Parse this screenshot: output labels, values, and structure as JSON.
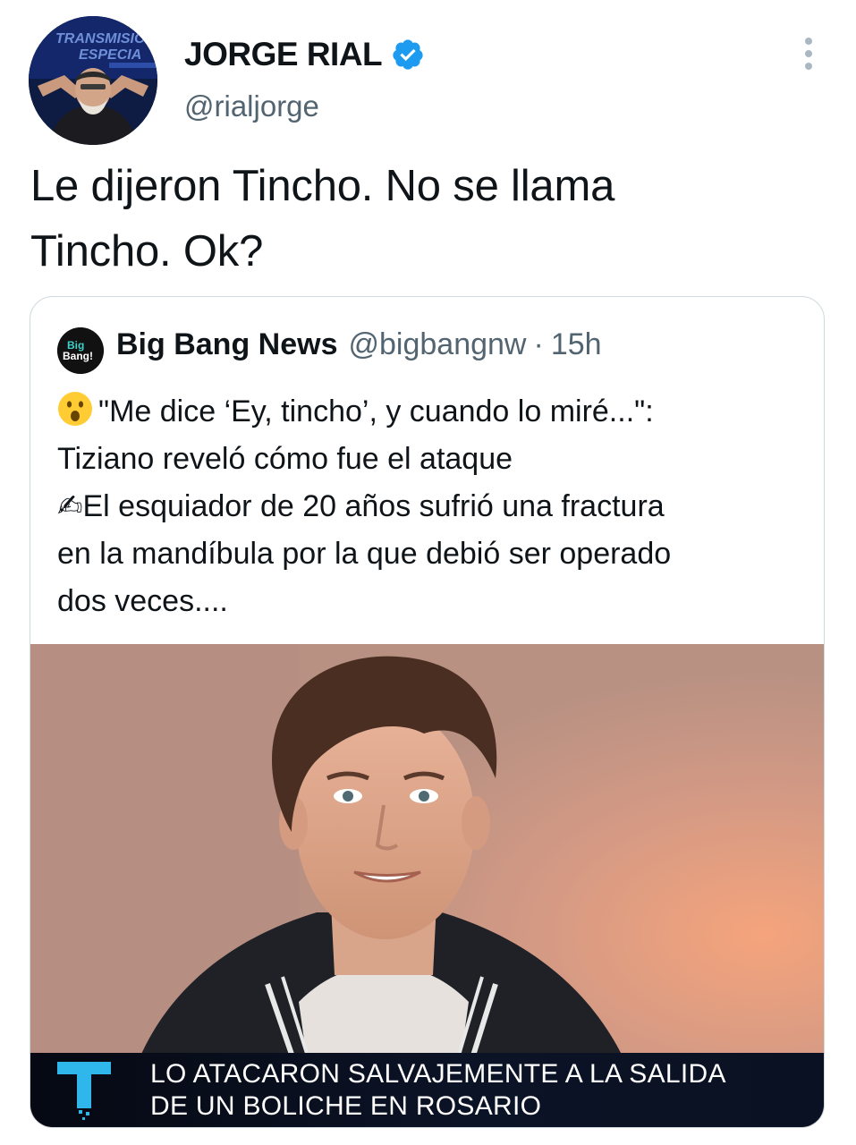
{
  "tweet": {
    "author_name": "JORGE RIAL",
    "author_handle": "@rialjorge",
    "avatar_overlay_text": [
      "TRANSMISIÓ",
      "ESPECIA"
    ],
    "text_line1": "Le dijeron Tincho. No se llama",
    "text_line2": "Tincho. Ok?",
    "more_icon": "more-vertical-icon",
    "verified_icon": "verified-badge-icon",
    "accent_color": "#1d9bf0"
  },
  "quote": {
    "avatar_text": [
      "Big",
      "Bang!"
    ],
    "author_name": "Big Bang News",
    "author_handle": "@bigbangnw",
    "separator": "·",
    "time": "15h",
    "emoji_icon": "surprised-face-emoji",
    "line1": "\"Me dice ‘Ey, tincho’, y cuando lo miré...\":",
    "line2": "Tiziano reveló cómo fue el ataque",
    "line3": "✍El esquiador de 20 años sufrió una fractura",
    "line4": "en la mandíbula por la que debió ser operado",
    "line5": "dos veces...."
  },
  "media": {
    "channel_logo": "T",
    "caption_line1": "LO ATACARON SALVAJEMENTE A LA SALIDA",
    "caption_line2": "DE UN BOLICHE EN ROSARIO"
  }
}
